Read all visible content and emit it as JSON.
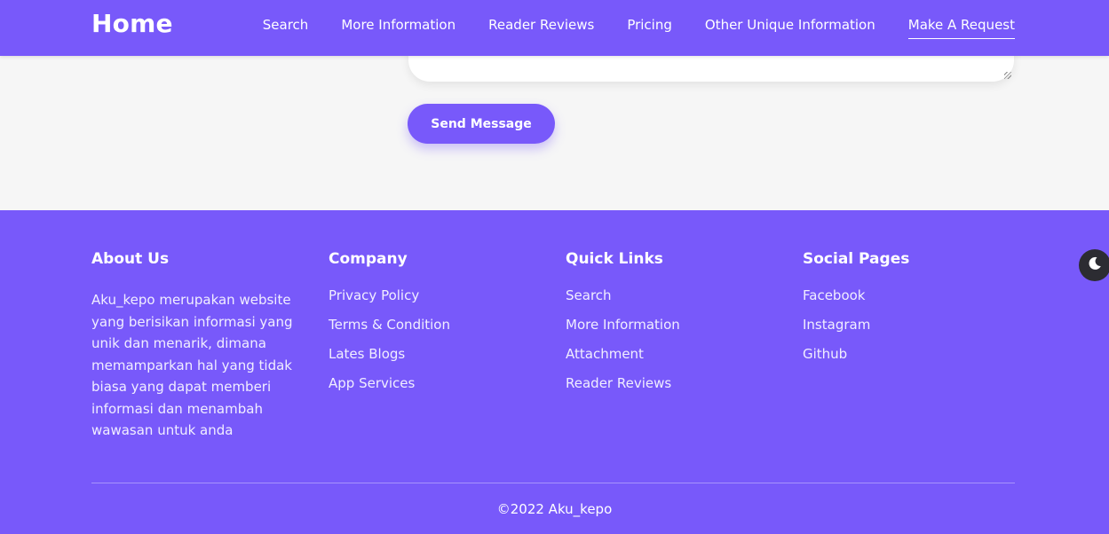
{
  "nav": {
    "brand": "Home",
    "links": [
      {
        "label": "Search"
      },
      {
        "label": "More Information"
      },
      {
        "label": "Reader Reviews"
      },
      {
        "label": "Pricing"
      },
      {
        "label": "Other Unique Information"
      },
      {
        "label": "Make A Request"
      }
    ]
  },
  "contact_form": {
    "send_label": "Send Message"
  },
  "footer": {
    "about": {
      "title": "About Us",
      "text": "Aku_kepo merupakan website yang berisikan informasi yang unik dan menarik, dimana memamparkan hal yang tidak biasa yang dapat memberi informasi dan menambah wawasan untuk anda"
    },
    "company": {
      "title": "Company",
      "links": [
        "Privacy Policy",
        "Terms & Condition",
        "Lates Blogs",
        "App Services"
      ]
    },
    "quick_links": {
      "title": "Quick Links",
      "links": [
        "Search",
        "More Information",
        "Attachment",
        "Reader Reviews"
      ]
    },
    "social": {
      "title": "Social Pages",
      "links": [
        "Facebook",
        "Instagram",
        "Github"
      ]
    },
    "copyright": "©2022 Aku_kepo"
  },
  "theme_toggle": {
    "icon": "moon-icon"
  },
  "colors": {
    "accent": "#7859fa",
    "background": "#f6f6f6",
    "toggle": "#2c2c32"
  }
}
